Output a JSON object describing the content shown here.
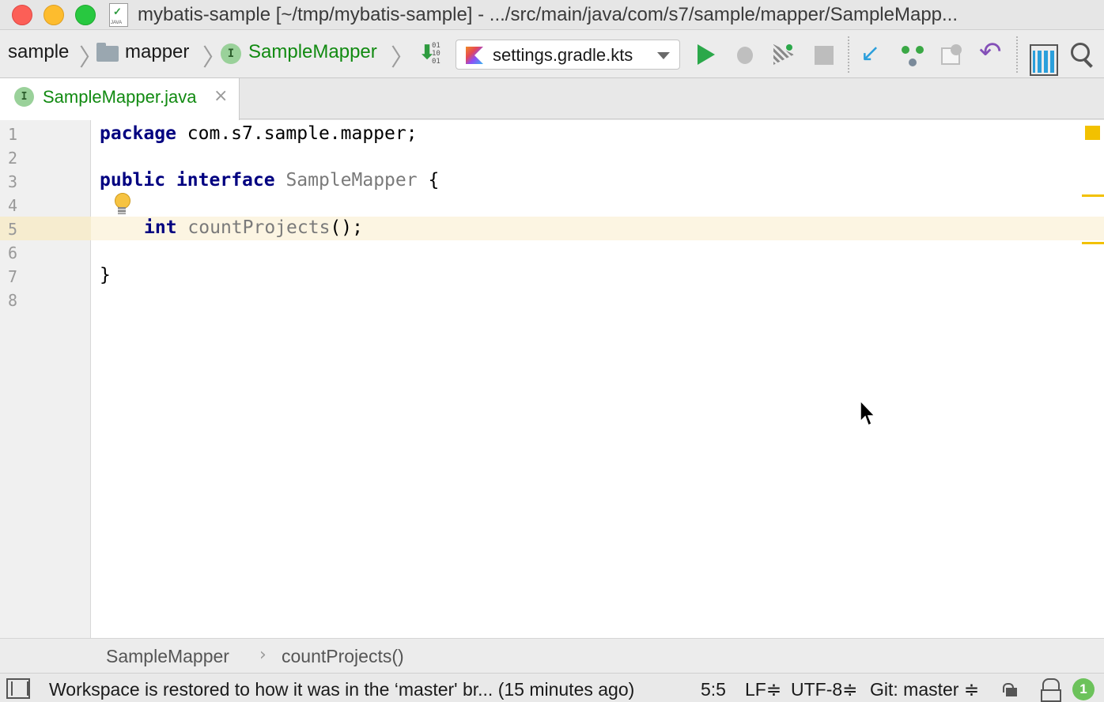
{
  "window": {
    "title": "mybatis-sample [~/tmp/mybatis-sample] - .../src/main/java/com/s7/sample/mapper/SampleMapp..."
  },
  "file_icon_label": "JAVA",
  "navbar": {
    "crumbs": [
      "sample",
      "mapper",
      "SampleMapper"
    ],
    "interface_badge": "I",
    "run_config": "settings.gradle.kts",
    "binary_bits": "01\n10\n01"
  },
  "tab": {
    "label": "SampleMapper.java",
    "close": "×",
    "badge": "I"
  },
  "editor": {
    "line_numbers": [
      "1",
      "2",
      "3",
      "4",
      "5",
      "6",
      "7",
      "8"
    ],
    "code": {
      "l1_kw": "package",
      "l1_rest": " com.s7.sample.mapper;",
      "l3_kw1": "public",
      "l3_kw2": "interface",
      "l3_name": "SampleMapper",
      "l3_brace": " {",
      "l5_kw": "int",
      "l5_name": "countProjects",
      "l5_rest": "();",
      "l7": "}"
    }
  },
  "code_breadcrumb": {
    "items": [
      "SampleMapper",
      "countProjects()"
    ],
    "separator": "›"
  },
  "statusbar": {
    "message": "Workspace is restored to how it was in the ‘master' br... (15 minutes ago)",
    "position": "5:5",
    "line_separator": "LF≑",
    "encoding": "UTF-8≑",
    "vcs": "Git: master ≑",
    "notifications": "1"
  },
  "colors": {
    "keyword": "#000080",
    "green_label": "#118a11",
    "marker": "#f2c100",
    "current_line": "#fcf5e2"
  },
  "icons": [
    "folder-icon",
    "interface-icon",
    "run-icon",
    "debug-icon",
    "coverage-icon",
    "stop-icon",
    "vcs-update-icon",
    "vcs-commit-icon",
    "vcs-history-icon",
    "revert-icon",
    "project-structure-icon",
    "search-icon",
    "intention-bulb-icon",
    "lock-icon",
    "hector-icon"
  ]
}
